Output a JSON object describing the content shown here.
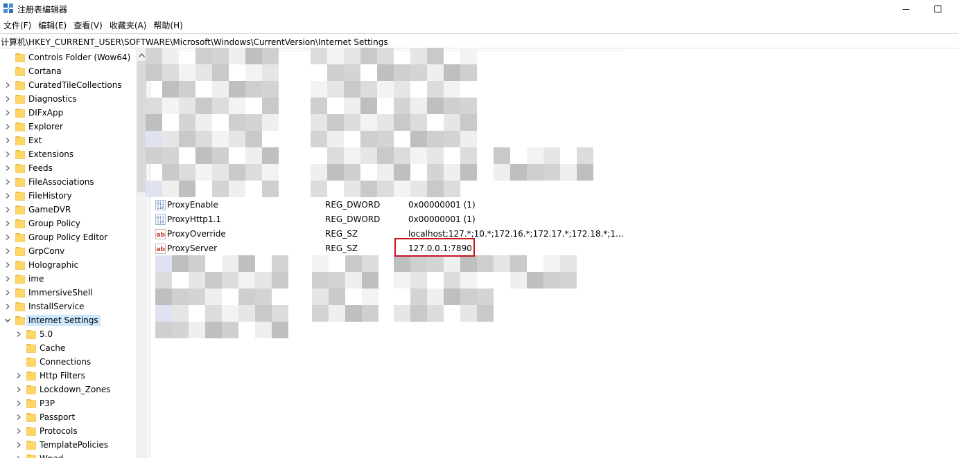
{
  "window": {
    "title": "注册表编辑器",
    "icon": "regedit-icon",
    "controls": [
      "minimize-icon",
      "maximize-icon"
    ]
  },
  "menu": [
    "文件(F)",
    "编辑(E)",
    "查看(V)",
    "收藏夹(A)",
    "帮助(H)"
  ],
  "address": {
    "path": "计算机\\HKEY_CURRENT_USER\\SOFTWARE\\Microsoft\\Windows\\CurrentVersion\\Internet Settings"
  },
  "tree": {
    "items": [
      {
        "label": "Controls Folder (Wow64)",
        "level": 1,
        "expander": "none"
      },
      {
        "label": "Cortana",
        "level": 1,
        "expander": "none"
      },
      {
        "label": "CuratedTileCollections",
        "level": 1,
        "expander": "collapsed"
      },
      {
        "label": "Diagnostics",
        "level": 1,
        "expander": "collapsed"
      },
      {
        "label": "DIFxApp",
        "level": 1,
        "expander": "collapsed"
      },
      {
        "label": "Explorer",
        "level": 1,
        "expander": "collapsed"
      },
      {
        "label": "Ext",
        "level": 1,
        "expander": "collapsed"
      },
      {
        "label": "Extensions",
        "level": 1,
        "expander": "collapsed"
      },
      {
        "label": "Feeds",
        "level": 1,
        "expander": "collapsed"
      },
      {
        "label": "FileAssociations",
        "level": 1,
        "expander": "collapsed"
      },
      {
        "label": "FileHistory",
        "level": 1,
        "expander": "collapsed"
      },
      {
        "label": "GameDVR",
        "level": 1,
        "expander": "collapsed"
      },
      {
        "label": "Group Policy",
        "level": 1,
        "expander": "collapsed"
      },
      {
        "label": "Group Policy Editor",
        "level": 1,
        "expander": "collapsed"
      },
      {
        "label": "GrpConv",
        "level": 1,
        "expander": "collapsed"
      },
      {
        "label": "Holographic",
        "level": 1,
        "expander": "collapsed"
      },
      {
        "label": "ime",
        "level": 1,
        "expander": "collapsed"
      },
      {
        "label": "ImmersiveShell",
        "level": 1,
        "expander": "collapsed"
      },
      {
        "label": "InstallService",
        "level": 1,
        "expander": "collapsed"
      },
      {
        "label": "Internet Settings",
        "level": 1,
        "expander": "expanded",
        "selected": true
      },
      {
        "label": "5.0",
        "level": 2,
        "expander": "collapsed"
      },
      {
        "label": "Cache",
        "level": 2,
        "expander": "none"
      },
      {
        "label": "Connections",
        "level": 2,
        "expander": "none"
      },
      {
        "label": "Http Filters",
        "level": 2,
        "expander": "collapsed"
      },
      {
        "label": "Lockdown_Zones",
        "level": 2,
        "expander": "collapsed"
      },
      {
        "label": "P3P",
        "level": 2,
        "expander": "collapsed"
      },
      {
        "label": "Passport",
        "level": 2,
        "expander": "collapsed"
      },
      {
        "label": "Protocols",
        "level": 2,
        "expander": "collapsed"
      },
      {
        "label": "TemplatePolicies",
        "level": 2,
        "expander": "collapsed"
      },
      {
        "label": "Wpad",
        "level": 2,
        "expander": "collapsed"
      }
    ]
  },
  "values": [
    {
      "name": "ProxyEnable",
      "type": "REG_DWORD",
      "data": "0x00000001 (1)",
      "icon": "reg-dword-icon"
    },
    {
      "name": "ProxyHttp1.1",
      "type": "REG_DWORD",
      "data": "0x00000001 (1)",
      "icon": "reg-dword-icon"
    },
    {
      "name": "ProxyOverride",
      "type": "REG_SZ",
      "data": "localhost;127.*;10.*;172.16.*;172.17.*;172.18.*;1...",
      "icon": "reg-sz-icon"
    },
    {
      "name": "ProxyServer",
      "type": "REG_SZ",
      "data": "127.0.0.1:7890",
      "icon": "reg-sz-icon",
      "highlighted": true
    }
  ],
  "colors": {
    "selection": "#cce8ff",
    "highlight_box": "#c4161c",
    "folder": "#ffd767",
    "folder_dark": "#e8b73c",
    "reg_sz_red": "#c0392b",
    "reg_dword_blue": "#2a5db0"
  }
}
